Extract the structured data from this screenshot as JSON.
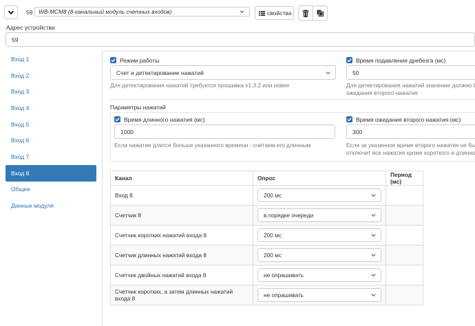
{
  "toolbar": {
    "device_index": "59",
    "device_select": "WB-MCM8 (8-канальный модуль счетных входов)",
    "properties_label": "свойства"
  },
  "address": {
    "label": "Адрес устройства",
    "value": "59"
  },
  "sidebar": {
    "items": [
      {
        "label": "Вход 1",
        "active": false
      },
      {
        "label": "Вход 2",
        "active": false
      },
      {
        "label": "Вход 3",
        "active": false
      },
      {
        "label": "Вход 4",
        "active": false
      },
      {
        "label": "Вход 5",
        "active": false
      },
      {
        "label": "Вход 6",
        "active": false
      },
      {
        "label": "Вход 7",
        "active": false
      },
      {
        "label": "Вход 8",
        "active": true
      },
      {
        "label": "Общее",
        "active": false
      },
      {
        "label": "Данные модуля",
        "active": false
      }
    ]
  },
  "settings": {
    "mode": {
      "label": "Режим работы",
      "value": "Счет и детектирование нажатий",
      "help": "Для детектирования нажатий требуется прошивка v1.3.2 или новее"
    },
    "debounce": {
      "label": "Время подавления дребезга (мс)",
      "value": "50",
      "help_line1": "Для детектирования нажатий значение должно быть",
      "help_line2": "ожидания второго нажатия"
    },
    "press_params_label": "Параметры нажатий",
    "long_press": {
      "label": "Время длинного нажатия (мс)",
      "value": "1000",
      "help": "Если нажатие длится больше указанного времени - считаем его длинным"
    },
    "second_press": {
      "label": "Время ожидания второго нажатия (мс)",
      "value": "300",
      "help_line1": "Если за указанное время второго нажатия не было с",
      "help_line2": "отключит все нажатия кроме короткого и длинного"
    }
  },
  "channels": {
    "headers": {
      "channel": "Канал",
      "poll": "Опрос",
      "period": "Период (мс)"
    },
    "rows": [
      {
        "name": "Вход 8",
        "poll": "200 мс"
      },
      {
        "name": "Счетчик 8",
        "poll": "в порядке очереди"
      },
      {
        "name": "Счетчик коротких нажатий входа 8",
        "poll": "200 мс"
      },
      {
        "name": "Счетчик длинных нажатий входа 8",
        "poll": "200 мс"
      },
      {
        "name": "Счетчик двойных нажатий входа 8",
        "poll": "не опрашивать"
      },
      {
        "name": "Счетчик коротких, а затем длинных нажатий входа 8",
        "poll": "не опрашивать"
      }
    ]
  },
  "colors": {
    "accent": "#337ab7",
    "link": "#2f6fb5",
    "border": "#cccccc"
  }
}
